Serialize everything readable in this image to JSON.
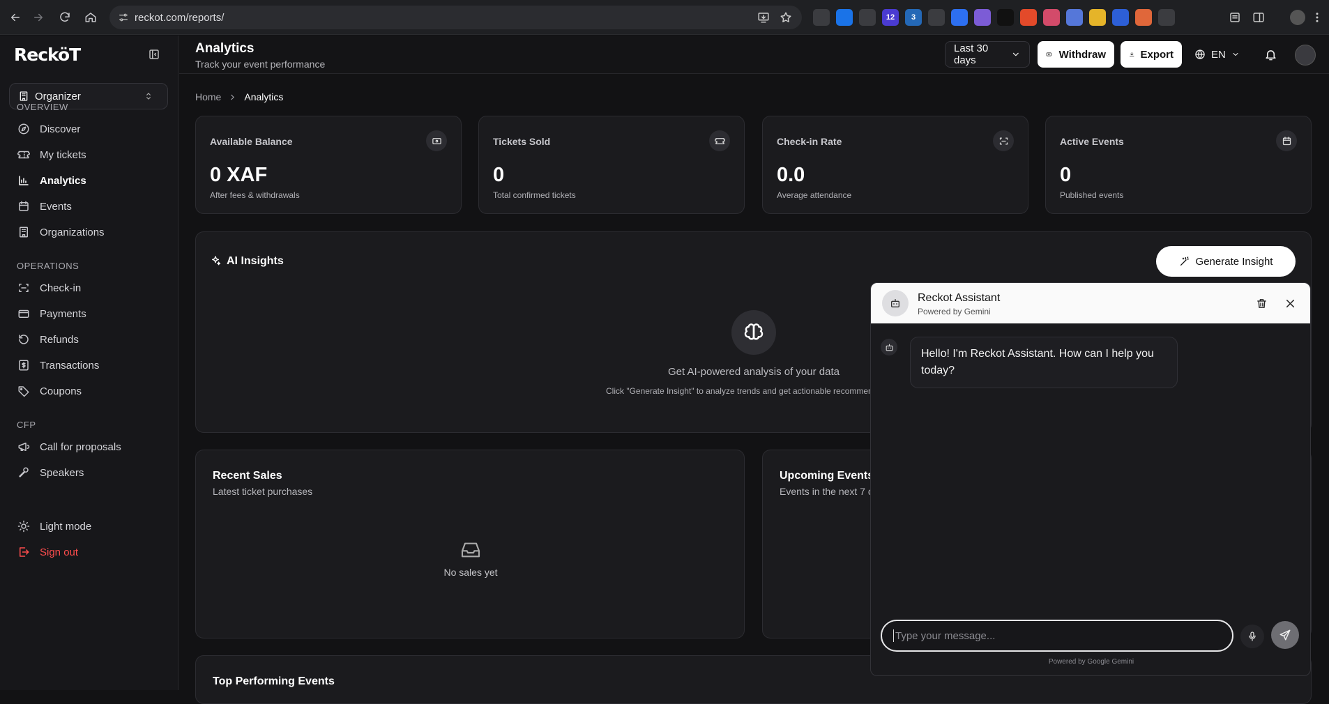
{
  "browser": {
    "url": "reckot.com/reports/",
    "extensions": [
      {
        "icon": "react-icon",
        "color": "#3b3c40",
        "badge": ""
      },
      {
        "icon": "translate-icon",
        "color": "#1a73e8",
        "badge": ""
      },
      {
        "icon": "window-icon",
        "color": "#3b3c40",
        "badge": ""
      },
      {
        "icon": "counter-icon",
        "color": "#4a3bd1",
        "badge": "12"
      },
      {
        "icon": "puzzle-icon",
        "color": "#2468b6",
        "badge": "3"
      },
      {
        "icon": "check-circle-icon",
        "color": "#3b3c40",
        "badge": ""
      },
      {
        "icon": "blue-dot-icon",
        "color": "#2d6ff0",
        "badge": ""
      },
      {
        "icon": "cloud-icon",
        "color": "#7c5cd6",
        "badge": ""
      },
      {
        "icon": "text-icon",
        "color": "#111111",
        "badge": ""
      },
      {
        "icon": "figma-icon",
        "color": "#e34a2a",
        "badge": ""
      },
      {
        "icon": "palette-icon",
        "color": "#d34b6a",
        "badge": ""
      },
      {
        "icon": "capture-icon",
        "color": "#5577d9",
        "badge": ""
      },
      {
        "icon": "pencil-icon",
        "color": "#e5b429",
        "badge": ""
      },
      {
        "icon": "shield-icon",
        "color": "#2d5fd6",
        "badge": ""
      },
      {
        "icon": "sun-burst-icon",
        "color": "#e0673a",
        "badge": ""
      },
      {
        "icon": "extensions-icon",
        "color": "#3b3c40",
        "badge": ""
      }
    ]
  },
  "sidebar": {
    "logo": "RecköT",
    "org_selector": "Organizer",
    "sections": {
      "overview": "OVERVIEW",
      "operations": "OPERATIONS",
      "cfp": "CFP"
    },
    "items": {
      "discover": "Discover",
      "my_tickets": "My tickets",
      "analytics": "Analytics",
      "events": "Events",
      "organizations": "Organizations",
      "checkin": "Check-in",
      "payments": "Payments",
      "refunds": "Refunds",
      "transactions": "Transactions",
      "coupons": "Coupons",
      "cfp": "Call for proposals",
      "speakers": "Speakers",
      "light_mode": "Light mode",
      "sign_out": "Sign out"
    },
    "sign_out_color": "#ff4d4d"
  },
  "header": {
    "title": "Analytics",
    "subtitle": "Track your event performance",
    "range": "Last 30 days",
    "withdraw": "Withdraw",
    "export": "Export",
    "language": "EN"
  },
  "breadcrumb": {
    "home": "Home",
    "current": "Analytics"
  },
  "stats": [
    {
      "label": "Available Balance",
      "value": "0 XAF",
      "sub": "After fees & withdrawals",
      "icon": "banknote-icon"
    },
    {
      "label": "Tickets Sold",
      "value": "0",
      "sub": "Total confirmed tickets",
      "icon": "ticket-icon"
    },
    {
      "label": "Check-in Rate",
      "value": "0.0",
      "sub": "Average attendance",
      "icon": "scan-icon"
    },
    {
      "label": "Active Events",
      "value": "0",
      "sub": "Published events",
      "icon": "calendar-icon"
    }
  ],
  "ai_insights": {
    "title": "AI Insights",
    "button": "Generate Insight",
    "empty_title": "Get AI-powered analysis of your data",
    "empty_desc": "Click \"Generate Insight\" to analyze trends and get actionable recommen"
  },
  "recent_sales": {
    "title": "Recent Sales",
    "subtitle": "Latest ticket purchases",
    "empty": "No sales yet"
  },
  "upcoming": {
    "title": "Upcoming Events",
    "subtitle": "Events in the next 7 c"
  },
  "top_performing": {
    "title": "Top Performing Events"
  },
  "chat": {
    "name": "Reckot Assistant",
    "powered": "Powered by Gemini",
    "message": "Hello! I'm Reckot Assistant. How can I help you today?",
    "placeholder": "Type your message...",
    "footer": "Powered by Google Gemini"
  }
}
